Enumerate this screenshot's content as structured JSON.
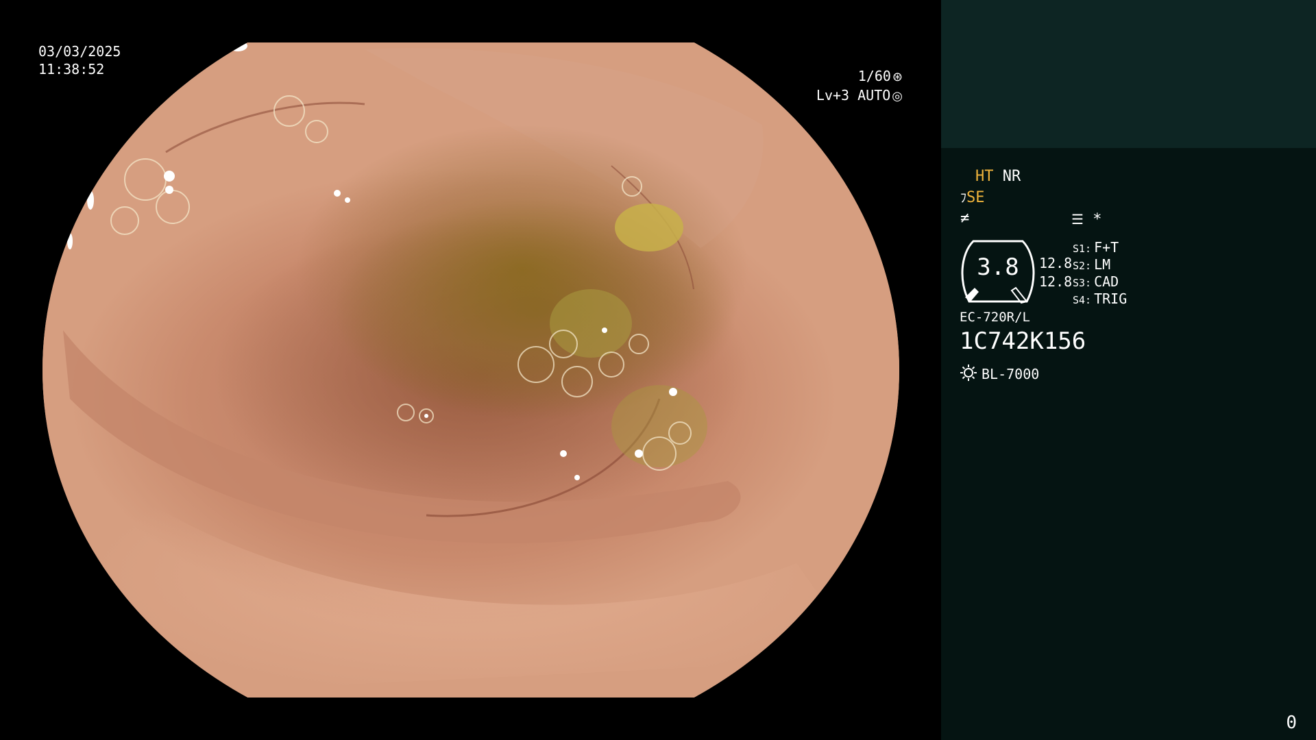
{
  "overlay": {
    "date": "03/03/2025",
    "time": "11:38:52",
    "shutter": "1/60",
    "shutter_icon": "aperture-icon",
    "exposure": "Lv+3 AUTO",
    "exposure_icon": "auto-exposure-icon"
  },
  "panel": {
    "mode_primary": "HT",
    "mode_secondary": "NR",
    "se_label": "SE",
    "se_icon": "signal-enhance-icon",
    "flag_icon": "filter-off-icon",
    "aux_icon": "settings-list-icon",
    "aux_symbol": "*",
    "gauge_value": "3.8",
    "level_1": "12.8",
    "level_2": "12.8",
    "switches": [
      {
        "key": "S1:",
        "value": "F+T"
      },
      {
        "key": "S2:",
        "value": "LM"
      },
      {
        "key": "S3:",
        "value": "CAD"
      },
      {
        "key": "S4:",
        "value": "TRIG"
      }
    ],
    "scope_model": "EC-720R/L",
    "scope_serial": "1C742K156",
    "light_source": "BL-7000",
    "light_icon": "light-bulb-icon"
  },
  "frame_counter": "0",
  "colors": {
    "panel_bg": "#051412",
    "patient_box_bg": "#0d2523",
    "highlight": "#f0b43c",
    "text": "#ffffff"
  }
}
